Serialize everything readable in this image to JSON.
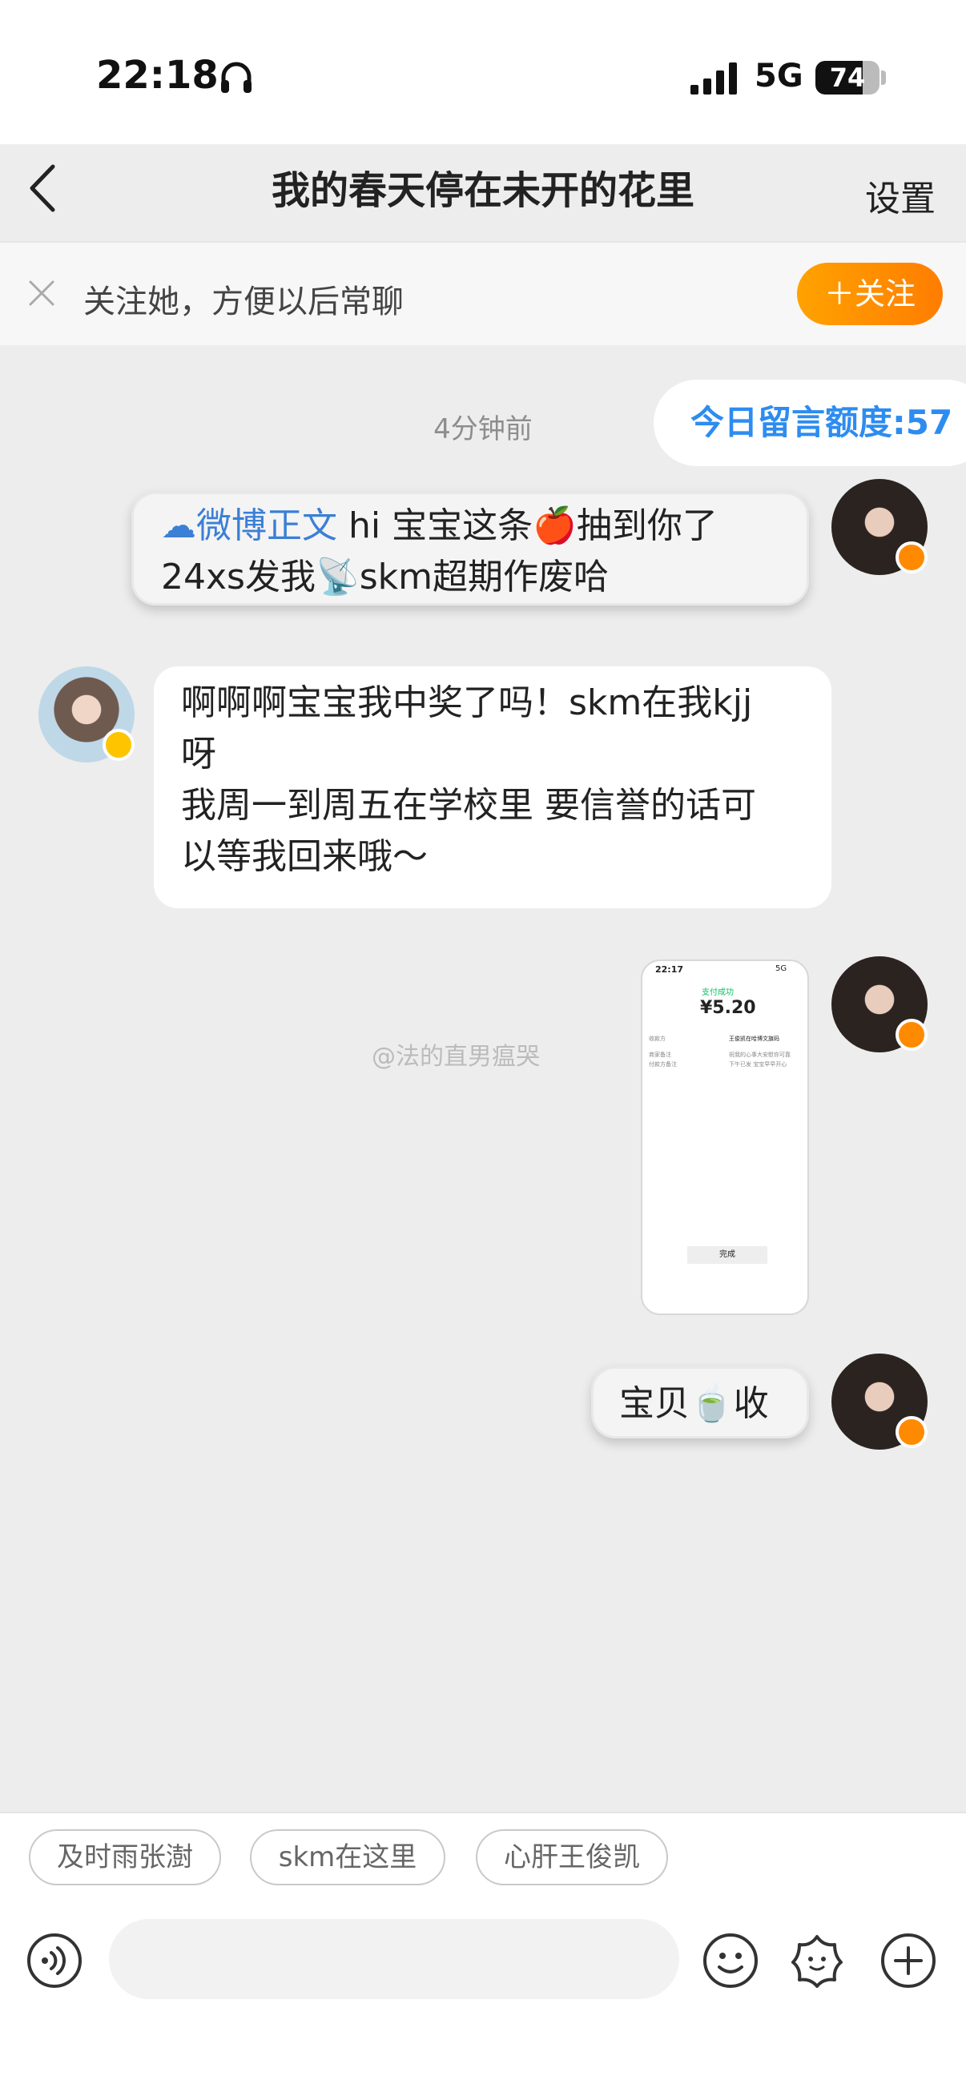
{
  "status": {
    "time": "22:18",
    "network": "5G",
    "battery": "74",
    "battery_level": 0.74
  },
  "header": {
    "title": "我的春天停在未开的花里",
    "settings_label": "设置"
  },
  "follow_bar": {
    "text": "关注她，方便以后常聊",
    "button_label": "＋关注"
  },
  "chat": {
    "timestamp": "4分钟前",
    "quota_label": "今日留言额度:57",
    "messages": [
      {
        "side": "right",
        "link": "微博正文",
        "line1": " hi 宝宝这条🍎抽到你了",
        "line2": "24xs发我📡skm超期作废哈"
      },
      {
        "side": "left",
        "line1": "啊啊啊宝宝我中奖了吗！skm在我kjj",
        "line2": "呀",
        "line3": "我周一到周五在学校里 要信誉的话可",
        "line4": "以等我回来哦～"
      },
      {
        "side": "right",
        "type": "image",
        "image": {
          "time": "22:17",
          "network": "5G",
          "status": "支付成功",
          "amount": "¥5.20",
          "row1_label": "收款方",
          "row1_value": "王俊凯在哈博文旗码",
          "row2_label": "商家备注",
          "row2_value": "祝我的心事大安慰你可靠",
          "row3_label": "付款方备注",
          "row3_value": "下午已发 宝宝早早开心",
          "button": "完成"
        }
      },
      {
        "side": "right",
        "text": "宝贝🍵收"
      }
    ],
    "watermark": "@法的直男瘟哭"
  },
  "suggestions": [
    "及时雨张澍",
    "skm在这里",
    "心肝王俊凯"
  ],
  "colors": {
    "accent": "#ff8a00",
    "link": "#2d8cf0",
    "background": "#ededed"
  }
}
